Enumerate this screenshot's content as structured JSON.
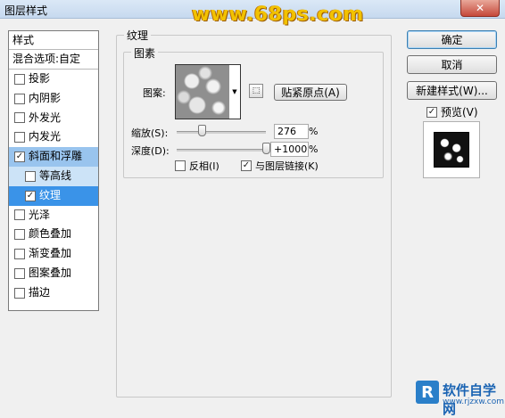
{
  "window": {
    "title": "图层样式",
    "watermark": "www.68ps.com",
    "close_label": "✕"
  },
  "style_list": {
    "header": "样式",
    "blend_options": "混合选项:自定",
    "items": [
      {
        "label": "投影",
        "checked": false
      },
      {
        "label": "内阴影",
        "checked": false
      },
      {
        "label": "外发光",
        "checked": false
      },
      {
        "label": "内发光",
        "checked": false
      },
      {
        "label": "斜面和浮雕",
        "checked": true
      },
      {
        "label": "等高线",
        "checked": false
      },
      {
        "label": "纹理",
        "checked": true
      },
      {
        "label": "光泽",
        "checked": false
      },
      {
        "label": "颜色叠加",
        "checked": false
      },
      {
        "label": "渐变叠加",
        "checked": false
      },
      {
        "label": "图案叠加",
        "checked": false
      },
      {
        "label": "描边",
        "checked": false
      }
    ]
  },
  "texture": {
    "group_title": "纹理",
    "elements_title": "图素",
    "pattern_label": "图案:",
    "snap_button": "贴紧原点(A)",
    "scale_label": "缩放(S):",
    "scale_value": "276",
    "scale_unit": "%",
    "scale_level_pct": 276,
    "depth_label": "深度(D):",
    "depth_value": "+1000",
    "depth_unit": "%",
    "depth_level_pct": 1000,
    "invert_label": "反相(I)",
    "invert_checked": false,
    "link_label": "与图层链接(K)",
    "link_checked": true
  },
  "buttons": {
    "ok": "确定",
    "cancel": "取消",
    "new_style": "新建样式(W)...",
    "preview_label": "预览(V)",
    "preview_checked": true
  },
  "brand": {
    "name": "软件自学网",
    "url": "www.rjzxw.com",
    "logo_letter": "R"
  },
  "check_mark": "✓"
}
